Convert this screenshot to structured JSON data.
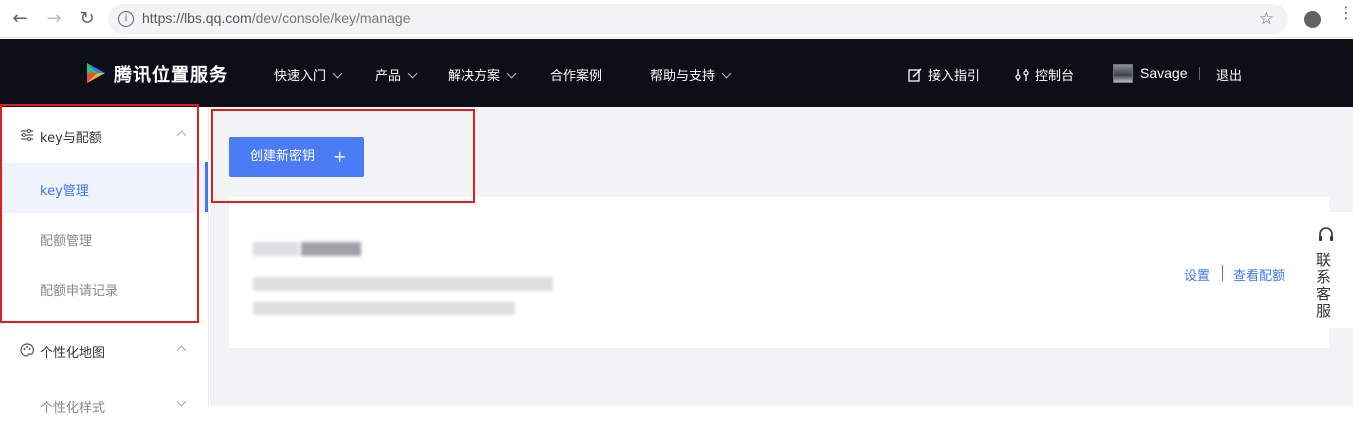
{
  "browser": {
    "url_host": "https://lbs.qq.com",
    "url_path": "/dev/console/key/manage"
  },
  "topnav": {
    "brand": "腾讯位置服务",
    "menu": [
      {
        "label": "快速入门",
        "has_dropdown": true
      },
      {
        "label": "产品",
        "has_dropdown": true
      },
      {
        "label": "解决方案",
        "has_dropdown": true
      },
      {
        "label": "合作案例",
        "has_dropdown": false
      },
      {
        "label": "帮助与支持",
        "has_dropdown": true
      }
    ],
    "guide": "接入指引",
    "console": "控制台",
    "username": "Savage",
    "logout": "退出"
  },
  "sidebar": {
    "group1": "key与配额",
    "items": [
      "key管理",
      "配额管理",
      "配额申请记录"
    ],
    "group2": "个性化地图",
    "group2_items": [
      "个性化样式"
    ]
  },
  "main": {
    "create_button": "创建新密钥",
    "create_button_icon": "+",
    "card_actions": [
      "设置",
      "查看配额"
    ]
  },
  "float": {
    "customer_service": "联系客服"
  },
  "colors": {
    "accent": "#4474f0",
    "nav_bg": "#0c0f18",
    "highlight": "#e02020"
  }
}
